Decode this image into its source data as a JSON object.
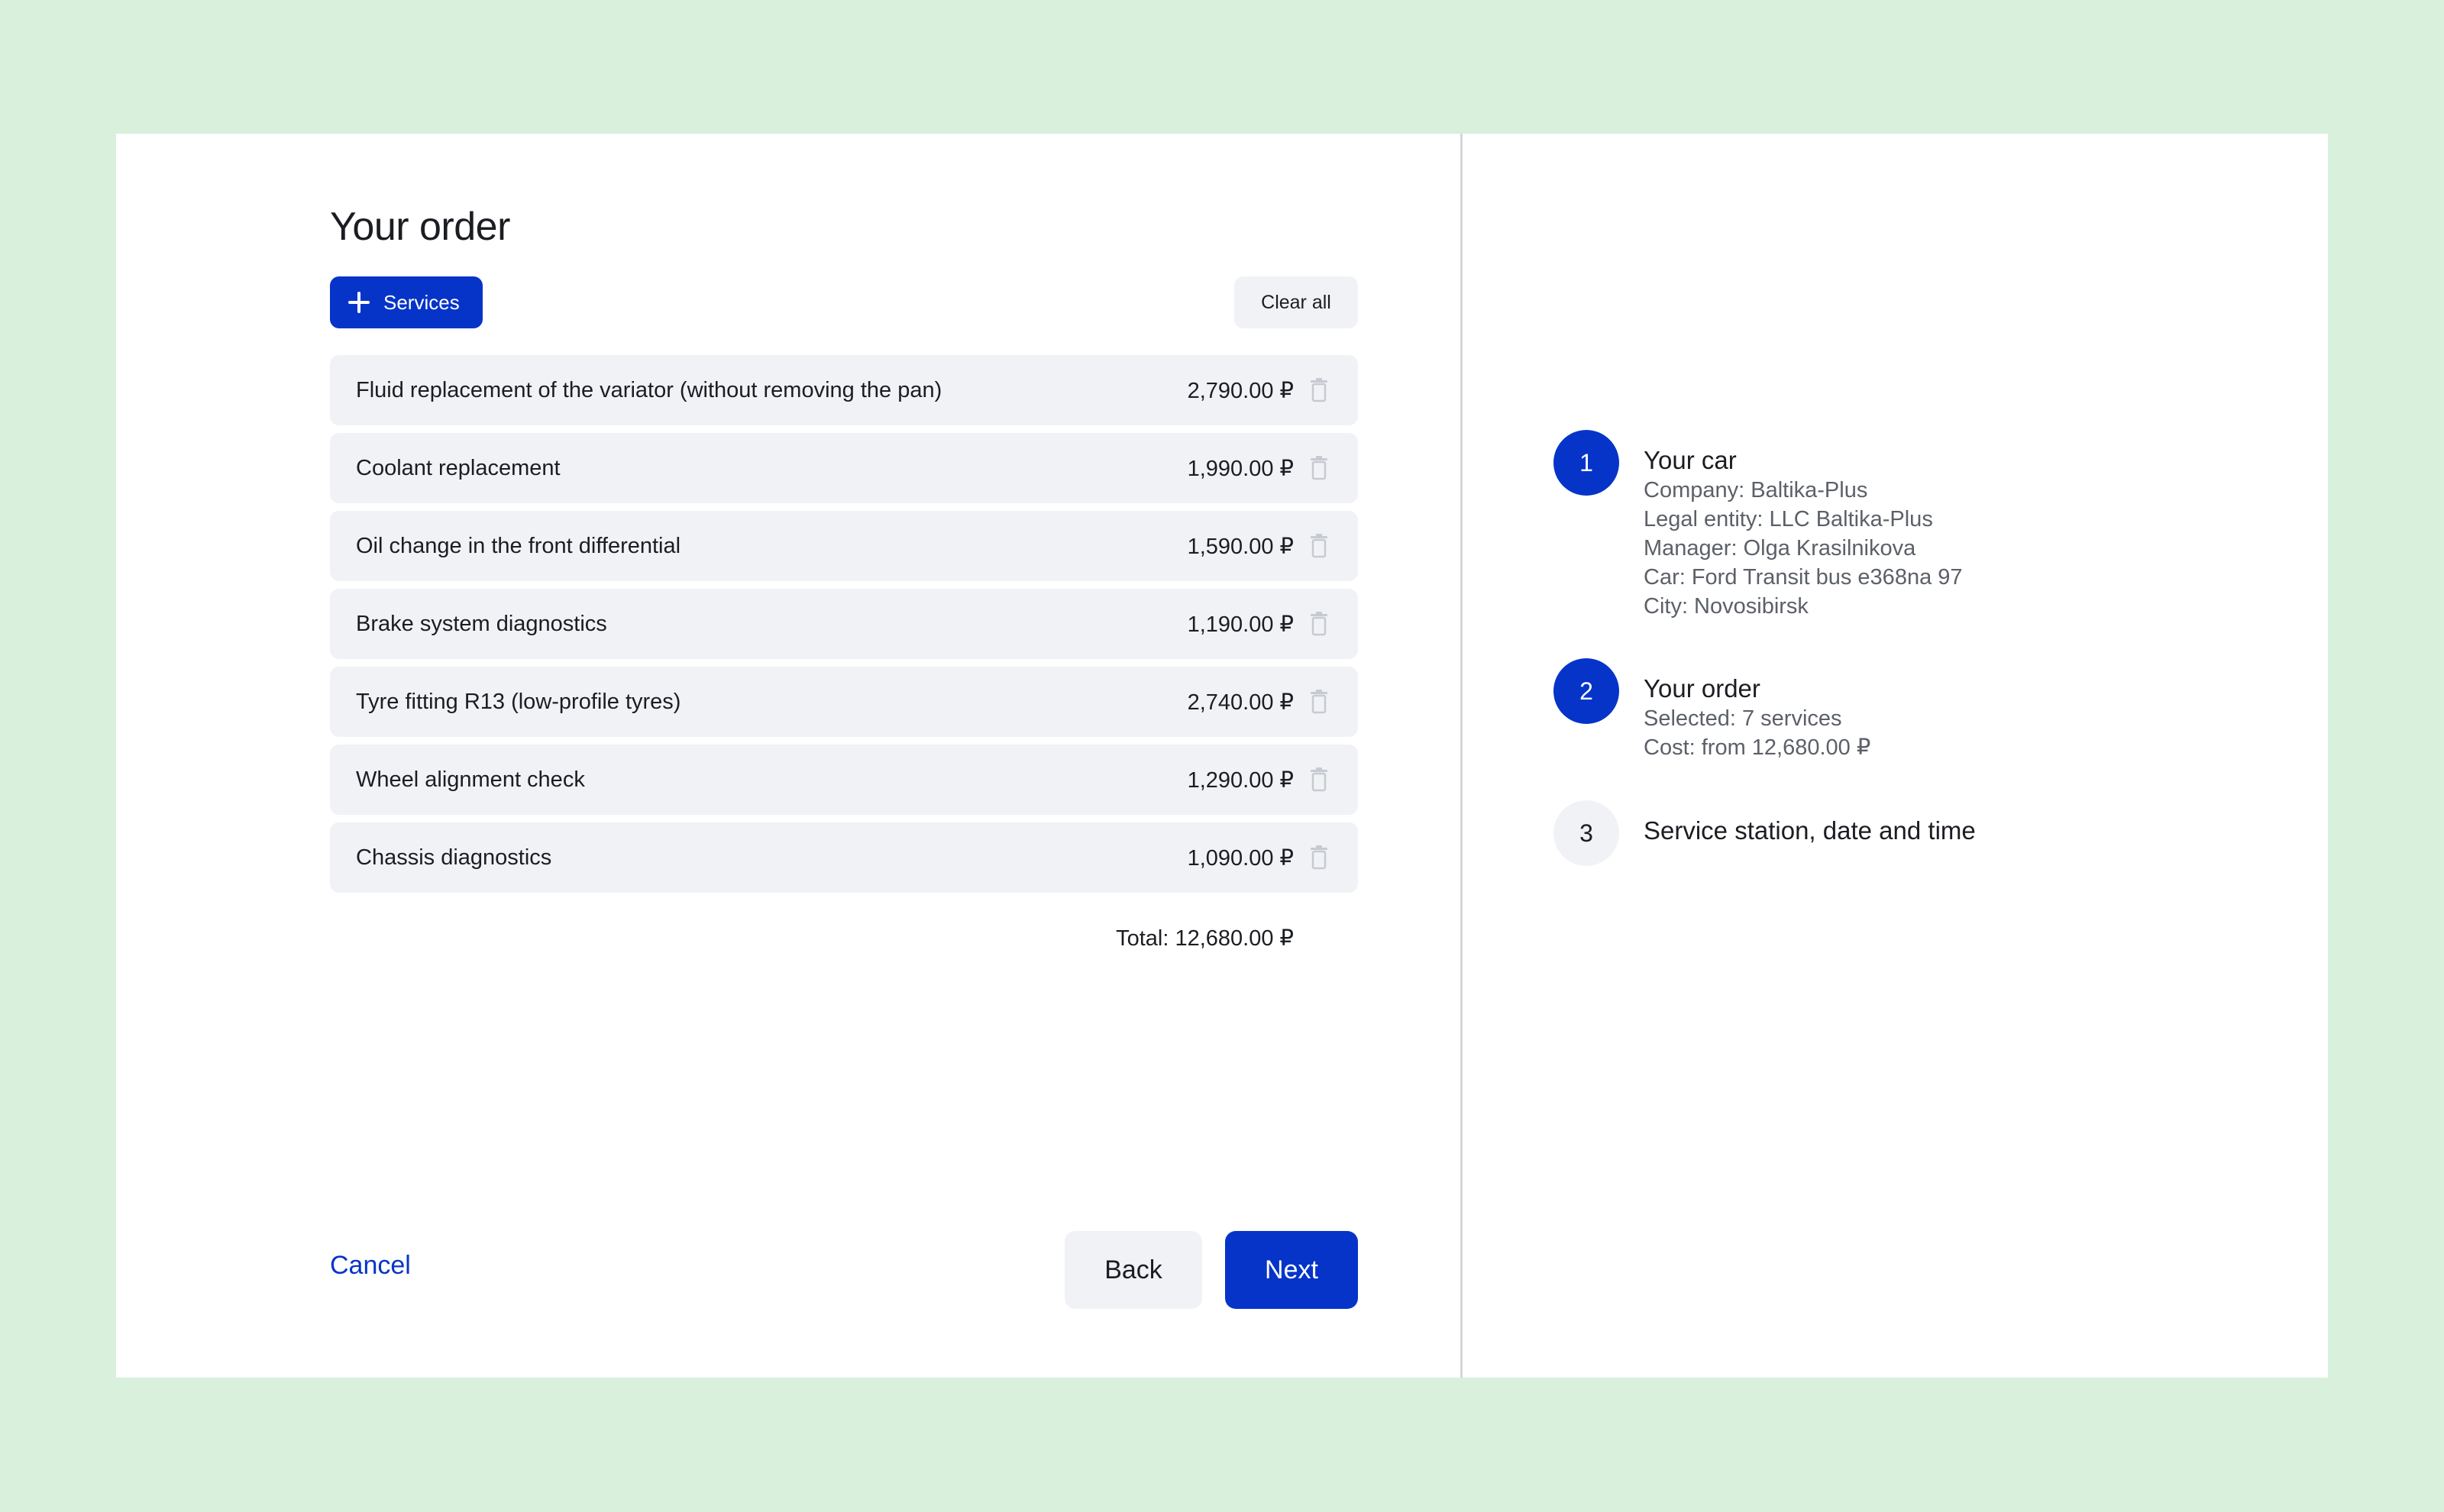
{
  "order": {
    "title": "Your order",
    "add_services_label": "Services",
    "clear_all_label": "Clear all",
    "items": [
      {
        "name": "Fluid replacement of the variator (without removing the pan)",
        "price": "2,790.00 ₽"
      },
      {
        "name": "Coolant replacement",
        "price": "1,990.00 ₽"
      },
      {
        "name": "Oil change in the front differential",
        "price": "1,590.00 ₽"
      },
      {
        "name": "Brake system diagnostics",
        "price": "1,190.00 ₽"
      },
      {
        "name": "Tyre fitting R13 (low-profile tyres)",
        "price": "2,740.00 ₽"
      },
      {
        "name": "Wheel alignment check",
        "price": "1,290.00 ₽"
      },
      {
        "name": "Chassis diagnostics",
        "price": "1,090.00 ₽"
      }
    ],
    "total_label": "Total:",
    "total_value": "12,680.00 ₽"
  },
  "footer": {
    "cancel_label": "Cancel",
    "back_label": "Back",
    "next_label": "Next"
  },
  "steps": [
    {
      "number": "1",
      "title": "Your car",
      "lines": [
        "Company: Baltika-Plus",
        "Legal entity: LLC Baltika-Plus",
        "Manager: Olga Krasilnikova",
        "Car: Ford Transit bus е368na 97",
        "City: Novosibirsk"
      ]
    },
    {
      "number": "2",
      "title": "Your order",
      "lines": [
        "Selected: 7 services",
        "Cost: from 12,680.00 ₽"
      ]
    },
    {
      "number": "3",
      "title": "Service station, date and time",
      "lines": []
    }
  ],
  "colors": {
    "background": "#d8f0dc",
    "accent": "#0634c9",
    "surface": "#f0f2f6",
    "icons": {
      "add": "plus-icon",
      "delete": "trash-icon"
    }
  }
}
